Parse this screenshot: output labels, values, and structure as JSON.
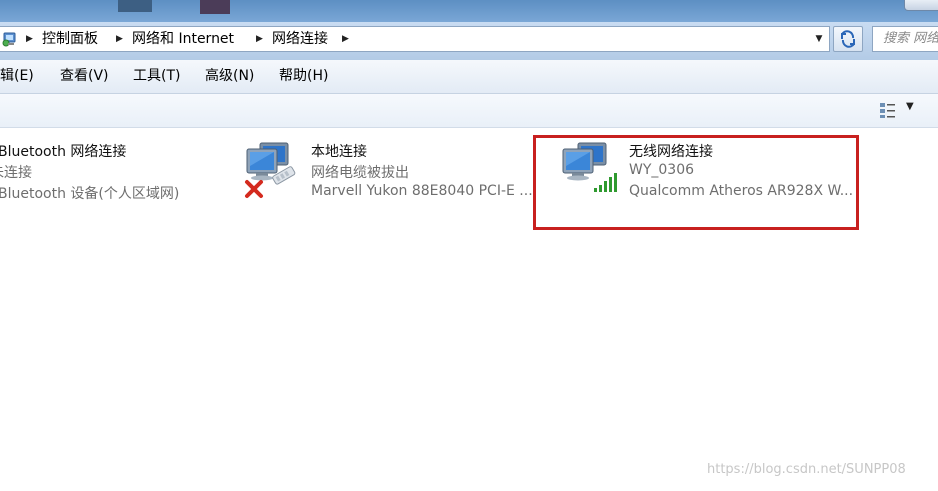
{
  "address_bar": {
    "crumbs": [
      "控制面板",
      "网络和 Internet",
      "网络连接"
    ],
    "search_placeholder": "搜索 网络"
  },
  "menu": {
    "items": [
      "编辑(E)",
      "查看(V)",
      "工具(T)",
      "高级(N)",
      "帮助(H)"
    ]
  },
  "connections": [
    {
      "name": "Bluetooth 网络连接",
      "status": "未连接",
      "device": "Bluetooth 设备(个人区域网)"
    },
    {
      "name": "本地连接",
      "status": "网络电缆被拔出",
      "device": "Marvell Yukon 88E8040 PCI-E ..."
    },
    {
      "name": "无线网络连接",
      "status": "WY_0306",
      "device": "Qualcomm Atheros AR928X W..."
    }
  ],
  "watermark": "https://blog.csdn.net/SUNPP08",
  "colors": {
    "highlight": "#c8201f",
    "signal": "#2f9a2f",
    "disconnected": "#d42a1e"
  },
  "icons": {
    "network_computer": "network-computer-icon",
    "signal": "signal-bars-icon",
    "disconnected": "red-x-icon"
  }
}
